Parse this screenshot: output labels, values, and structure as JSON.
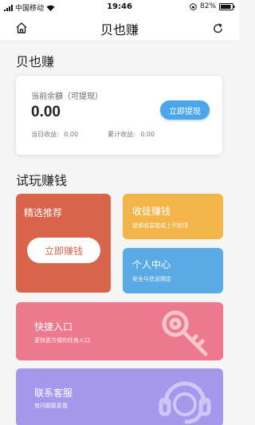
{
  "status_bar": {
    "carrier": "中国移动",
    "time": "19:46",
    "battery": "82%",
    "icons": [
      "signal-icon",
      "wifi-icon",
      "orientation-lock-icon",
      "battery-icon"
    ]
  },
  "nav": {
    "title": "贝也赚",
    "left_icon": "home-icon",
    "right_icon": "refresh-icon"
  },
  "account": {
    "section_title": "贝也赚",
    "balance_label": "当前余額（可提现）",
    "balance": "0.00",
    "withdraw_label": "立即提现",
    "today_label": "当日收益:",
    "today_value": "0.00",
    "total_label": "累计收益:",
    "total_value": "0.00"
  },
  "trial": {
    "section_title": "试玩赚钱",
    "recommend": {
      "title": "精选推荐",
      "button": "立即赚钱"
    },
    "earn": {
      "title": "收徒赚钱",
      "subtitle": "徒弟收益提成上不封顶"
    },
    "profile": {
      "title": "个人中心",
      "subtitle": "安全与信息绑定"
    },
    "quick": {
      "title": "快捷入口",
      "subtitle": "更快更方便的任务入口",
      "icon": "key-icon"
    },
    "service": {
      "title": "联系客服",
      "subtitle": "有问题联系我",
      "icon": "headset-icon"
    }
  },
  "colors": {
    "accent_blue": "#4aa6e8",
    "recommend": "#d8654b",
    "earn": "#f3b54a",
    "profile": "#5aabe5",
    "quick": "#ec7a8c",
    "service": "#a598ec"
  }
}
